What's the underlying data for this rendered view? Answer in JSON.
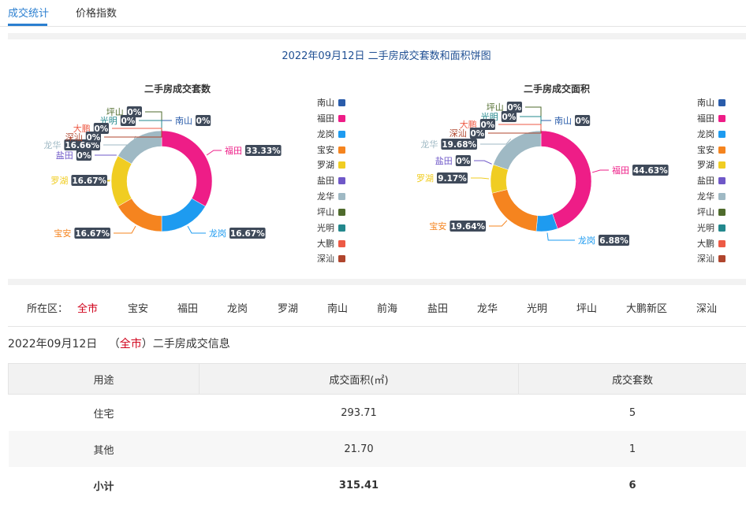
{
  "tabs": [
    {
      "label": "成交统计",
      "active": true
    },
    {
      "label": "价格指数",
      "active": false
    }
  ],
  "main_title": "2022年09月12日 二手房成交套数和面积饼图",
  "chart_data": [
    {
      "type": "pie",
      "title": "二手房成交套数",
      "slices": [
        {
          "name": "南山",
          "value": 0,
          "label": "0%"
        },
        {
          "name": "福田",
          "value": 33.33,
          "label": "33.33%"
        },
        {
          "name": "龙岗",
          "value": 16.67,
          "label": "16.67%"
        },
        {
          "name": "宝安",
          "value": 16.67,
          "label": "16.67%"
        },
        {
          "name": "罗湖",
          "value": 16.67,
          "label": "16.67%"
        },
        {
          "name": "盐田",
          "value": 0,
          "label": "0%"
        },
        {
          "name": "龙华",
          "value": 16.66,
          "label": "16.66%"
        },
        {
          "name": "坪山",
          "value": 0,
          "label": "0%"
        },
        {
          "name": "光明",
          "value": 0,
          "label": "0%"
        },
        {
          "name": "大鹏",
          "value": 0,
          "label": "0%"
        },
        {
          "name": "深汕",
          "value": 0,
          "label": "0%"
        }
      ],
      "legend": "right"
    },
    {
      "type": "pie",
      "title": "二手房成交面积",
      "slices": [
        {
          "name": "南山",
          "value": 0,
          "label": "0%"
        },
        {
          "name": "福田",
          "value": 44.63,
          "label": "44.63%"
        },
        {
          "name": "龙岗",
          "value": 6.88,
          "label": "6.88%"
        },
        {
          "name": "宝安",
          "value": 19.64,
          "label": "19.64%"
        },
        {
          "name": "罗湖",
          "value": 9.17,
          "label": "9.17%"
        },
        {
          "name": "盐田",
          "value": 0,
          "label": "0%"
        },
        {
          "name": "龙华",
          "value": 19.68,
          "label": "19.68%"
        },
        {
          "name": "坪山",
          "value": 0,
          "label": "0%"
        },
        {
          "name": "光明",
          "value": 0,
          "label": "0%"
        },
        {
          "name": "大鹏",
          "value": 0,
          "label": "0%"
        },
        {
          "name": "深汕",
          "value": 0,
          "label": "0%"
        }
      ],
      "legend": "right"
    }
  ],
  "colors": {
    "南山": "#2a5caa",
    "福田": "#ee1d87",
    "龙岗": "#1e9bf0",
    "宝安": "#f5841f",
    "罗湖": "#f0cd22",
    "盐田": "#6f58c8",
    "龙华": "#9fb9c4",
    "坪山": "#4f6b2c",
    "光明": "#23888d",
    "大鹏": "#ed5a45",
    "深汕": "#b0452d"
  },
  "district_filter": {
    "label": "所在区：",
    "items": [
      "全市",
      "宝安",
      "福田",
      "龙岗",
      "罗湖",
      "南山",
      "前海",
      "盐田",
      "龙华",
      "光明",
      "坪山",
      "大鹏新区",
      "深汕"
    ],
    "active": "全市"
  },
  "info": {
    "date": "2022年09月12日",
    "open_paren": "（",
    "scope": "全市",
    "close_paren": "）",
    "suffix": "二手房成交信息"
  },
  "table": {
    "headers": [
      "用途",
      "成交面积(㎡)",
      "成交套数"
    ],
    "rows": [
      [
        "住宅",
        "293.71",
        "5"
      ],
      [
        "其他",
        "21.70",
        "1"
      ]
    ],
    "total": [
      "小计",
      "315.41",
      "6"
    ]
  }
}
